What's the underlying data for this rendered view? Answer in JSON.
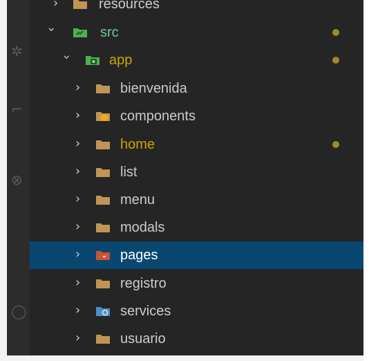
{
  "explorer": {
    "items": [
      {
        "label": "resources",
        "icon": "folder-icon",
        "state": "collapsed"
      },
      {
        "label": "src",
        "icon": "folder-src-icon",
        "state": "expanded"
      },
      {
        "label": "app",
        "icon": "folder-app-icon",
        "state": "expanded"
      },
      {
        "label": "bienvenida",
        "icon": "folder-icon",
        "state": "collapsed"
      },
      {
        "label": "components",
        "icon": "folder-components-icon",
        "state": "collapsed"
      },
      {
        "label": "home",
        "icon": "folder-icon",
        "state": "collapsed"
      },
      {
        "label": "list",
        "icon": "folder-icon",
        "state": "collapsed"
      },
      {
        "label": "menu",
        "icon": "folder-icon",
        "state": "collapsed"
      },
      {
        "label": "modals",
        "icon": "folder-icon",
        "state": "collapsed"
      },
      {
        "label": "pages",
        "icon": "folder-pages-icon",
        "state": "collapsed",
        "selected": true
      },
      {
        "label": "registro",
        "icon": "folder-icon",
        "state": "collapsed"
      },
      {
        "label": "services",
        "icon": "folder-services-icon",
        "state": "collapsed"
      },
      {
        "label": "usuario",
        "icon": "folder-icon",
        "state": "collapsed"
      }
    ]
  },
  "colors": {
    "sidebar_bg": "#252526",
    "activity_bar_bg": "#2c2c2c",
    "selection_bg": "#094771",
    "text": "#cccccc",
    "modified_text": "#cca700",
    "untracked_text": "#73c991",
    "modified_dot": "#9c8a2d",
    "folder": "#c09553",
    "src_folder": "#4caf50",
    "components_folder": "#f5a623",
    "pages_folder": "#e44d26",
    "services_folder": "#4a90c8"
  }
}
